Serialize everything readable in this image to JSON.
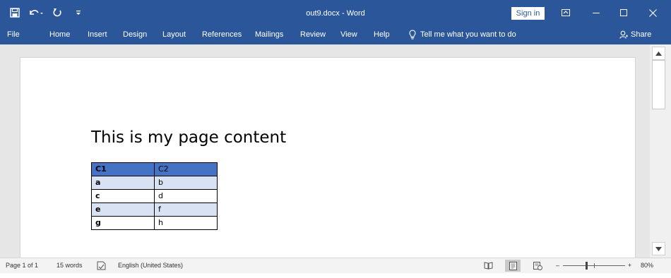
{
  "window": {
    "document_title": "out9.docx  -  Word",
    "sign_in_label": "Sign in"
  },
  "quick_access": {
    "icons": [
      "save-icon",
      "undo-icon",
      "redo-icon",
      "customize-qat-icon"
    ]
  },
  "menu": {
    "items": [
      "File",
      "Home",
      "Insert",
      "Design",
      "Layout",
      "References",
      "Mailings",
      "Review",
      "View",
      "Help"
    ],
    "tell_me": "Tell me what you want to do",
    "share": "Share"
  },
  "document": {
    "heading": "This is my page content",
    "table": {
      "rows": [
        [
          "C1",
          "C2"
        ],
        [
          "a",
          "b"
        ],
        [
          "c",
          "d"
        ],
        [
          "e",
          "f"
        ],
        [
          "g",
          "h"
        ]
      ]
    }
  },
  "status": {
    "page": "Page 1 of 1",
    "words": "15 words",
    "language": "English (United States)",
    "zoom": "80%",
    "zoom_value": 80
  },
  "colors": {
    "ribbon": "#2b579a",
    "table_header": "#4472c4",
    "table_band": "#d9e2f3"
  }
}
